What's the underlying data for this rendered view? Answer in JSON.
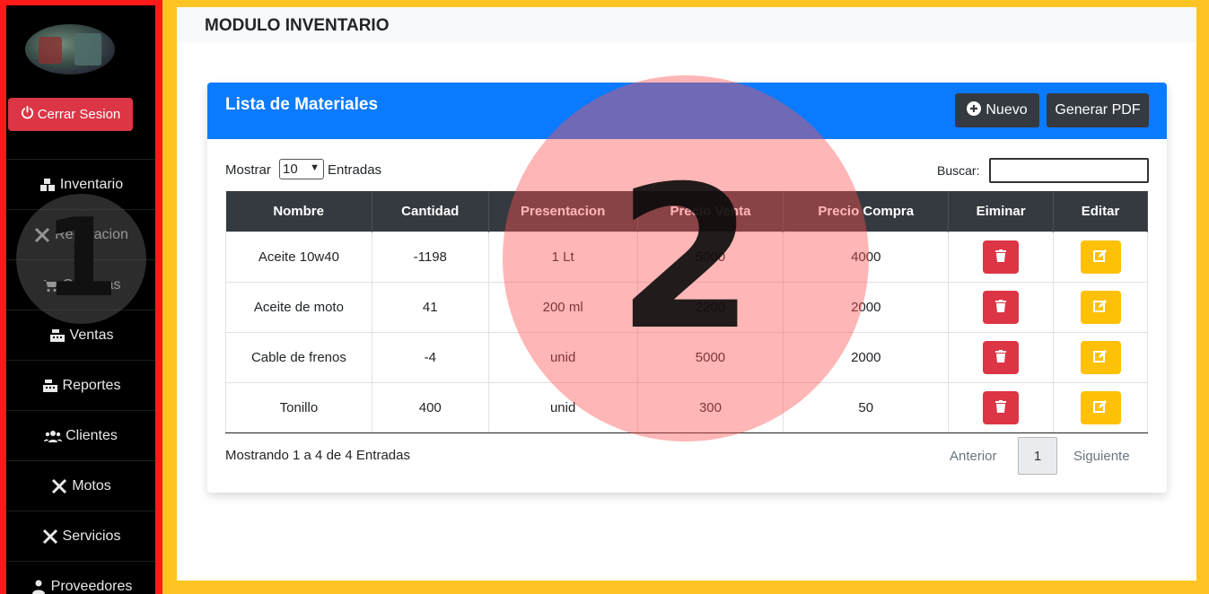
{
  "sidebar": {
    "logout_label": "Cerrar Sesion",
    "items": [
      {
        "label": "Inventario",
        "icon": "boxes-icon"
      },
      {
        "label": "Reparacion",
        "icon": "tools-icon"
      },
      {
        "label": "Compras",
        "icon": "cart-icon"
      },
      {
        "label": "Ventas",
        "icon": "cash-register-icon"
      },
      {
        "label": "Reportes",
        "icon": "cash-register-icon"
      },
      {
        "label": "Clientes",
        "icon": "users-icon"
      },
      {
        "label": "Motos",
        "icon": "tools-icon"
      },
      {
        "label": "Servicios",
        "icon": "tools-icon"
      },
      {
        "label": "Proveedores",
        "icon": "user-icon"
      }
    ]
  },
  "page": {
    "title": "MODULO INVENTARIO"
  },
  "card": {
    "title": "Lista de Materiales",
    "new_label": "Nuevo",
    "pdf_label": "Generar PDF"
  },
  "controls": {
    "show_label": "Mostrar",
    "show_value": "10",
    "entries_label": "Entradas",
    "search_label": "Buscar:"
  },
  "table": {
    "headers": [
      "Nombre",
      "Cantidad",
      "Presentacion",
      "Precio Venta",
      "Precio Compra",
      "Eiminar",
      "Editar"
    ],
    "rows": [
      [
        "Aceite 10w40",
        "-1198",
        "1 Lt",
        "5000",
        "4000"
      ],
      [
        "Aceite de moto",
        "41",
        "200 ml",
        "2200",
        "2000"
      ],
      [
        "Cable de frenos",
        "-4",
        "unid",
        "5000",
        "2000"
      ],
      [
        "Tonillo",
        "400",
        "unid",
        "300",
        "50"
      ]
    ]
  },
  "footer": {
    "info": "Mostrando 1 a 4 de 4 Entradas",
    "prev": "Anterior",
    "page": "1",
    "next": "Siguiente"
  },
  "annotations": {
    "one": "1",
    "two": "2"
  },
  "colors": {
    "frame": "#fec423",
    "sidebar_frame": "#ff1a1a",
    "header_blue": "#0a7bff",
    "danger": "#dc3545",
    "warning": "#ffc107",
    "dark": "#343a40"
  }
}
